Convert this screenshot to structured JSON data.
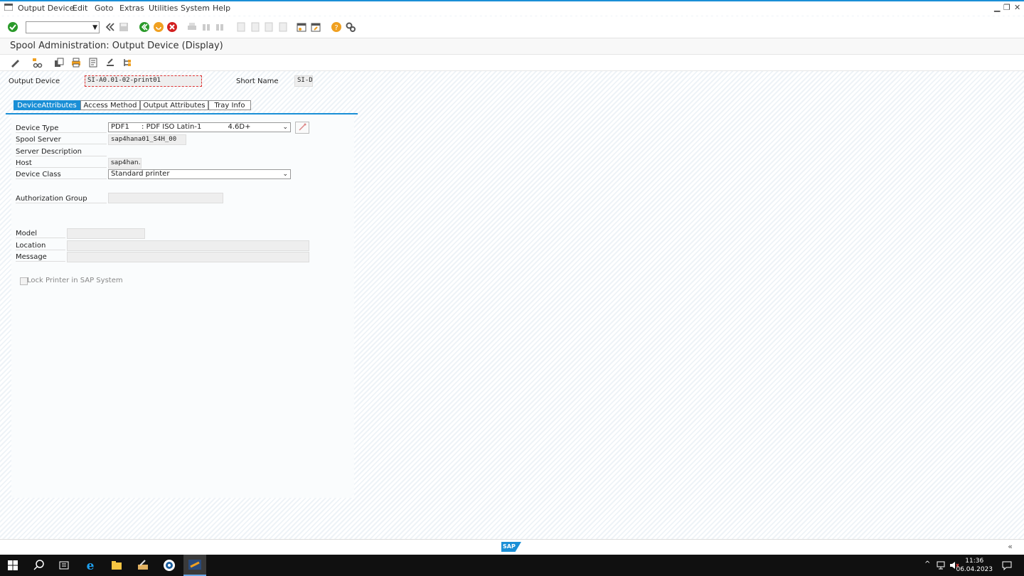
{
  "menu": {
    "items": [
      "Output Device",
      "Edit",
      "Goto",
      "Extras",
      "Utilities",
      "System",
      "Help"
    ]
  },
  "window_controls": [
    "minimize-icon",
    "restore-icon",
    "close-icon"
  ],
  "toolbar": {
    "command_field_value": "",
    "icons": [
      "enter-icon",
      "back-nav-icon",
      "save-icon",
      "back-icon",
      "exit-icon",
      "cancel-icon",
      "print-icon",
      "find-icon",
      "find-next-icon",
      "first-page-icon",
      "previous-page-icon",
      "next-page-icon",
      "last-page-icon",
      "create-session-icon",
      "shortcut-icon",
      "help-icon",
      "settings-icon"
    ]
  },
  "title": "Spool Administration: Output Device (Display)",
  "app_toolbar": {
    "icons": [
      "edit-pencil-icon",
      "hierarchy-icon",
      "copy-icon",
      "print-icon",
      "info-icon",
      "transport-icon",
      "tree-icon"
    ]
  },
  "header": {
    "output_device_label": "Output Device",
    "output_device_value": "SI-A0.01-02-print01",
    "short_name_label": "Short Name",
    "short_name_value": "SI-D"
  },
  "tabs": [
    {
      "label": "DeviceAttributes",
      "active": true
    },
    {
      "label": "Access Method",
      "active": false
    },
    {
      "label": "Output Attributes",
      "active": false
    },
    {
      "label": "Tray Info",
      "active": false
    }
  ],
  "form": {
    "device_type_label": "Device Type",
    "device_type_code": "PDF1",
    "device_type_desc": ": PDF ISO Latin-1",
    "device_type_version": "4.6D+",
    "spool_server_label": "Spool Server",
    "spool_server_value": "sap4hana01_S4H_00",
    "server_description_label": "Server Description",
    "host_label": "Host",
    "host_value": "sap4han…",
    "device_class_label": "Device Class",
    "device_class_value": "Standard printer",
    "authorization_group_label": "Authorization Group",
    "authorization_group_value": "",
    "model_label": "Model",
    "model_value": "",
    "location_label": "Location",
    "location_value": "",
    "message_label": "Message",
    "message_value": "",
    "lock_printer_label": "Lock Printer in SAP System",
    "lock_printer_checked": false
  },
  "status": {
    "logo": "SAP"
  },
  "taskbar": {
    "time": "11:36",
    "date": "06.04.2023"
  },
  "colors": {
    "accent": "#1a8fd6",
    "ok_green": "#2a9a2a",
    "cancel_red": "#d32020",
    "exit_orange": "#f0a020"
  }
}
